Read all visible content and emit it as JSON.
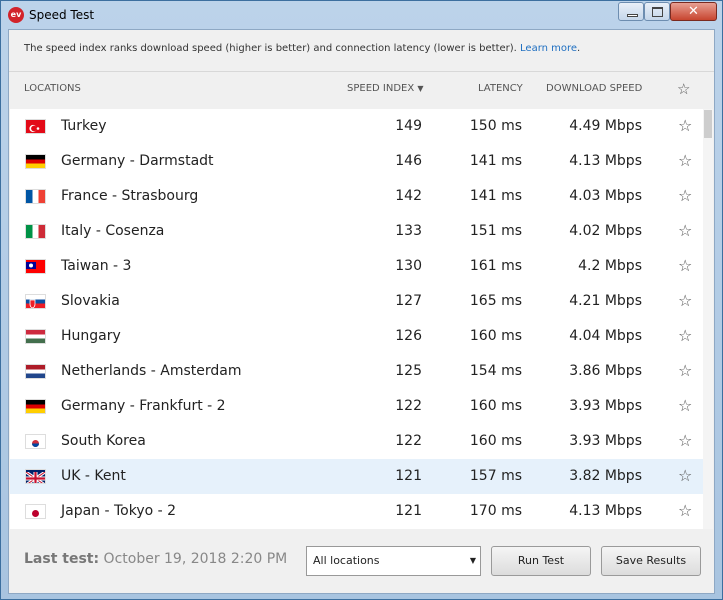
{
  "window": {
    "title": "Speed Test",
    "app_icon_text": "ev",
    "close_symbol": "✕"
  },
  "info": {
    "text": "The speed index ranks download speed (higher is better) and connection latency (lower is better). ",
    "link": "Learn more",
    "after_link": "."
  },
  "columns": {
    "locations": "LOCATIONS",
    "speed_index": "SPEED INDEX",
    "sort_glyph": "▼",
    "latency": "LATENCY",
    "download": "DOWNLOAD SPEED",
    "star_glyph": "☆"
  },
  "rows": [
    {
      "flag": "turkey",
      "location": "Turkey",
      "speed": "149",
      "latency": "150 ms",
      "download": "4.49 Mbps"
    },
    {
      "flag": "germany",
      "location": "Germany - Darmstadt",
      "speed": "146",
      "latency": "141 ms",
      "download": "4.13 Mbps"
    },
    {
      "flag": "france",
      "location": "France - Strasbourg",
      "speed": "142",
      "latency": "141 ms",
      "download": "4.03 Mbps"
    },
    {
      "flag": "italy",
      "location": "Italy - Cosenza",
      "speed": "133",
      "latency": "151 ms",
      "download": "4.02 Mbps"
    },
    {
      "flag": "taiwan",
      "location": "Taiwan - 3",
      "speed": "130",
      "latency": "161 ms",
      "download": "4.2 Mbps"
    },
    {
      "flag": "slovakia",
      "location": "Slovakia",
      "speed": "127",
      "latency": "165 ms",
      "download": "4.21 Mbps"
    },
    {
      "flag": "hungary",
      "location": "Hungary",
      "speed": "126",
      "latency": "160 ms",
      "download": "4.04 Mbps"
    },
    {
      "flag": "netherlands",
      "location": "Netherlands - Amsterdam",
      "speed": "125",
      "latency": "154 ms",
      "download": "3.86 Mbps"
    },
    {
      "flag": "germany",
      "location": "Germany - Frankfurt - 2",
      "speed": "122",
      "latency": "160 ms",
      "download": "3.93 Mbps"
    },
    {
      "flag": "south-korea",
      "location": "South Korea",
      "speed": "122",
      "latency": "160 ms",
      "download": "3.93 Mbps"
    },
    {
      "flag": "uk",
      "location": "UK - Kent",
      "speed": "121",
      "latency": "157 ms",
      "download": "3.82 Mbps",
      "selected": true
    },
    {
      "flag": "japan",
      "location": "Japan - Tokyo - 2",
      "speed": "121",
      "latency": "170 ms",
      "download": "4.13 Mbps"
    }
  ],
  "footer": {
    "last_test_label": "Last test:",
    "last_test_value": " October 19, 2018 2:20 PM",
    "filter_value": "All locations",
    "filter_arrow": "▼",
    "run_test": "Run Test",
    "save_results": "Save Results"
  },
  "colors": {
    "selected_row": "#e6f1fb",
    "link": "#1f6fc1"
  }
}
